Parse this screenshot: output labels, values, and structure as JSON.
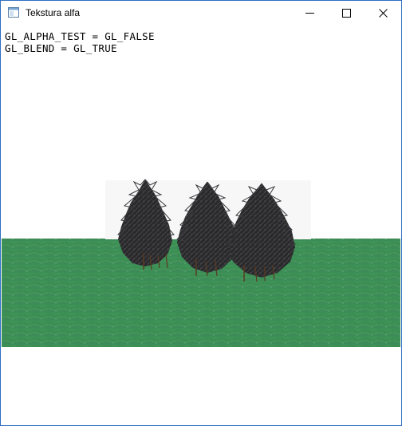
{
  "window": {
    "title": "Tekstura alfa",
    "controls": {
      "minimize": "minimize-icon",
      "maximize": "maximize-icon",
      "close": "close-icon"
    }
  },
  "overlay": {
    "lines": [
      "GL_ALPHA_TEST = GL_FALSE",
      "GL_BLEND = GL_TRUE"
    ]
  },
  "scene": {
    "background_color": "#ffffff",
    "ground_color": "#3f8f55",
    "tree_color": "#2b2b2d",
    "tree_count": 3
  }
}
